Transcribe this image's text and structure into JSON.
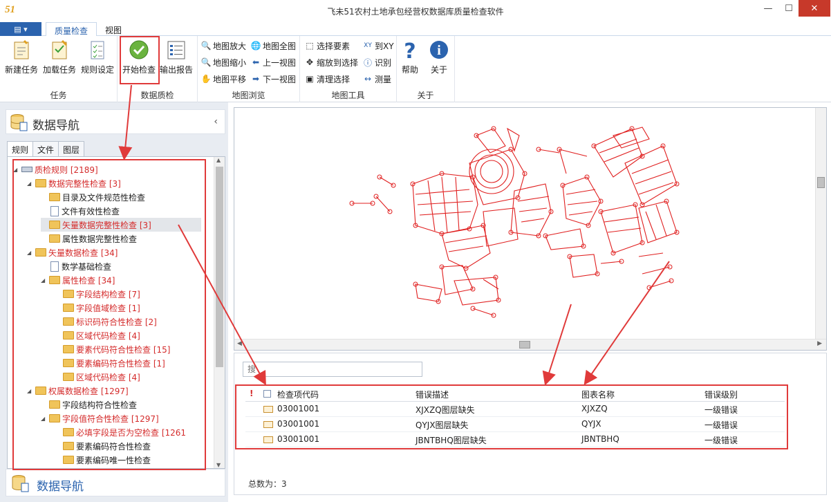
{
  "app": {
    "logo": "51",
    "title": "飞未51农村土地承包经营权数据库质量检查软件"
  },
  "window": {
    "minimize": "—",
    "maximize": "☐",
    "close": "✕"
  },
  "tabs": [
    {
      "label": "质量检查"
    },
    {
      "label": "视图"
    }
  ],
  "ribbon": {
    "task": {
      "label": "任务",
      "new": "新建任务",
      "load": "加载任务",
      "rule": "规则设定"
    },
    "qc": {
      "label": "数据质检",
      "start": "开始检查",
      "report": "输出报告"
    },
    "browse": {
      "label": "地图浏览",
      "zoom_in": "地图放大",
      "full": "地图全图",
      "zoom_out": "地图缩小",
      "prev": "上一视图",
      "pan": "地图平移",
      "next": "下一视图"
    },
    "tools": {
      "label": "地图工具",
      "select": "选择要素",
      "goto_xy": "到XY",
      "zoom_select": "缩放到选择",
      "identify": "识别",
      "clear": "清理选择",
      "measure": "测量"
    },
    "about": {
      "label": "关于",
      "help": "帮助",
      "about": "关于"
    }
  },
  "left": {
    "title": "数据导航",
    "footer": "数据导航",
    "tabs": [
      "规则",
      "文件",
      "图层"
    ],
    "tree": [
      {
        "label": "质检规则 [2189]",
        "level": 0,
        "icon": "root",
        "red": true,
        "arrow": true
      },
      {
        "label": "数据完整性检查 [3]",
        "level": 1,
        "icon": "folder",
        "red": true,
        "arrow": true
      },
      {
        "label": "目录及文件规范性检查",
        "level": 2,
        "icon": "folder",
        "red": false
      },
      {
        "label": "文件有效性检查",
        "level": 2,
        "icon": "file",
        "red": false
      },
      {
        "label": "矢量数据完整性检查 [3]",
        "level": 2,
        "icon": "folder",
        "red": true,
        "selected": true
      },
      {
        "label": "属性数据完整性检查",
        "level": 2,
        "icon": "folder",
        "red": false
      },
      {
        "label": "矢量数据检查 [34]",
        "level": 1,
        "icon": "folder",
        "red": true,
        "arrow": true
      },
      {
        "label": "数学基础检查",
        "level": 2,
        "icon": "file",
        "red": false
      },
      {
        "label": "属性检查 [34]",
        "level": 2,
        "icon": "folder",
        "red": true,
        "arrow": true
      },
      {
        "label": "字段结构检查 [7]",
        "level": 3,
        "icon": "folder",
        "red": true
      },
      {
        "label": "字段值域检查 [1]",
        "level": 3,
        "icon": "folder",
        "red": true
      },
      {
        "label": "标识码符合性检查 [2]",
        "level": 3,
        "icon": "folder",
        "red": true
      },
      {
        "label": "区域代码检查 [4]",
        "level": 3,
        "icon": "folder",
        "red": true
      },
      {
        "label": "要素代码符合性检查 [15]",
        "level": 3,
        "icon": "folder",
        "red": true
      },
      {
        "label": "要素编码符合性检查 [1]",
        "level": 3,
        "icon": "folder",
        "red": true
      },
      {
        "label": "区域代码检查 [4]",
        "level": 3,
        "icon": "folder",
        "red": true
      },
      {
        "label": "权属数据检查 [1297]",
        "level": 1,
        "icon": "folder",
        "red": true,
        "arrow": true
      },
      {
        "label": "字段结构符合性检查",
        "level": 2,
        "icon": "folder",
        "red": false
      },
      {
        "label": "字段值符合性检查 [1297]",
        "level": 2,
        "icon": "folder",
        "red": true,
        "arrow": true
      },
      {
        "label": "必填字段是否为空检查 [1261",
        "level": 3,
        "icon": "folder",
        "red": true
      },
      {
        "label": "要素编码符合性检查",
        "level": 3,
        "icon": "folder",
        "red": false
      },
      {
        "label": "要素编码唯一性检查",
        "level": 3,
        "icon": "folder",
        "red": false
      }
    ]
  },
  "results": {
    "search_placeholder": "搜",
    "columns": [
      "!",
      "检查项代码",
      "错误描述",
      "图表名称",
      "错误级别"
    ],
    "rows": [
      {
        "code": "03001001",
        "desc": "XJXZQ图层缺失",
        "name": "XJXZQ",
        "level": "一级错误"
      },
      {
        "code": "03001001",
        "desc": "QYJX图层缺失",
        "name": "QYJX",
        "level": "一级错误"
      },
      {
        "code": "03001001",
        "desc": "JBNTBHQ图层缺失",
        "name": "JBNTBHQ",
        "level": "一级错误"
      }
    ],
    "total": "总数为：3"
  },
  "colors": {
    "accent": "#2b63ae",
    "error": "#d42b2b",
    "annotation": "#e03a3a"
  }
}
